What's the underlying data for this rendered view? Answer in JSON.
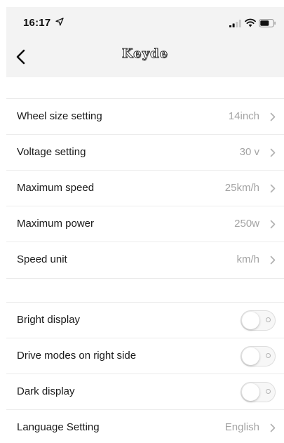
{
  "status_bar": {
    "time": "16:17",
    "icons": [
      "location-arrow-icon",
      "signal-icon",
      "wifi-icon",
      "battery-icon"
    ]
  },
  "nav": {
    "title": "Keyde",
    "back_icon": "chevron-left-icon"
  },
  "settings": {
    "wheel_size": {
      "label": "Wheel size setting",
      "value": "14inch"
    },
    "voltage": {
      "label": "Voltage setting",
      "value": "30 v"
    },
    "max_speed": {
      "label": "Maximum speed",
      "value": "25km/h"
    },
    "max_power": {
      "label": "Maximum power",
      "value": "250w"
    },
    "speed_unit": {
      "label": "Speed unit",
      "value": "km/h"
    }
  },
  "toggles": {
    "bright_display": {
      "label": "Bright display",
      "on": false
    },
    "drive_modes_right": {
      "label": "Drive modes on right side",
      "on": false
    },
    "dark_display": {
      "label": "Dark display",
      "on": false
    }
  },
  "language": {
    "label": "Language Setting",
    "value": "English"
  },
  "colors": {
    "nav_background": "#f3f3f3",
    "label_text": "#1a1a1a",
    "value_text": "#a3a3a3",
    "separator": "#ececec"
  }
}
